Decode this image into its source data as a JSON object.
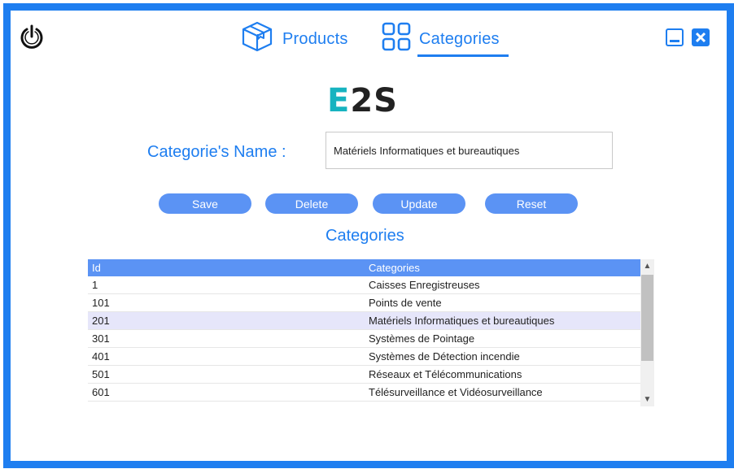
{
  "nav": {
    "products_label": "Products",
    "categories_label": "Categories",
    "active": "Categories"
  },
  "logo": {
    "e": "E",
    "rest": "2S"
  },
  "form": {
    "name_label": "Categorie's Name :",
    "name_value": "Matériels Informatiques et bureautiques"
  },
  "buttons": {
    "save": "Save",
    "delete": "Delete",
    "update": "Update",
    "reset": "Reset"
  },
  "section_title": "Categories",
  "table": {
    "headers": [
      "Id",
      "Categories"
    ],
    "rows": [
      {
        "id": "1",
        "name": "Caisses Enregistreuses"
      },
      {
        "id": "101",
        "name": "Points de vente"
      },
      {
        "id": "201",
        "name": "Matériels Informatiques et bureautiques"
      },
      {
        "id": "301",
        "name": "Systèmes de Pointage"
      },
      {
        "id": "401",
        "name": "Systèmes de Détection incendie"
      },
      {
        "id": "501",
        "name": "Réseaux et Télécommunications"
      },
      {
        "id": "601",
        "name": "Télésurveillance et Vidéosurveillance"
      }
    ],
    "selected_row_id": "201"
  },
  "icons": {
    "power": "power-icon",
    "products": "package-icon",
    "categories": "grid-icon",
    "minimize": "minimize-icon",
    "close": "close-icon"
  },
  "colors": {
    "accent": "#1e7ef0",
    "button": "#5b93f4",
    "logo_e": "#17b3c0",
    "selected_row": "#e6e6fa"
  }
}
